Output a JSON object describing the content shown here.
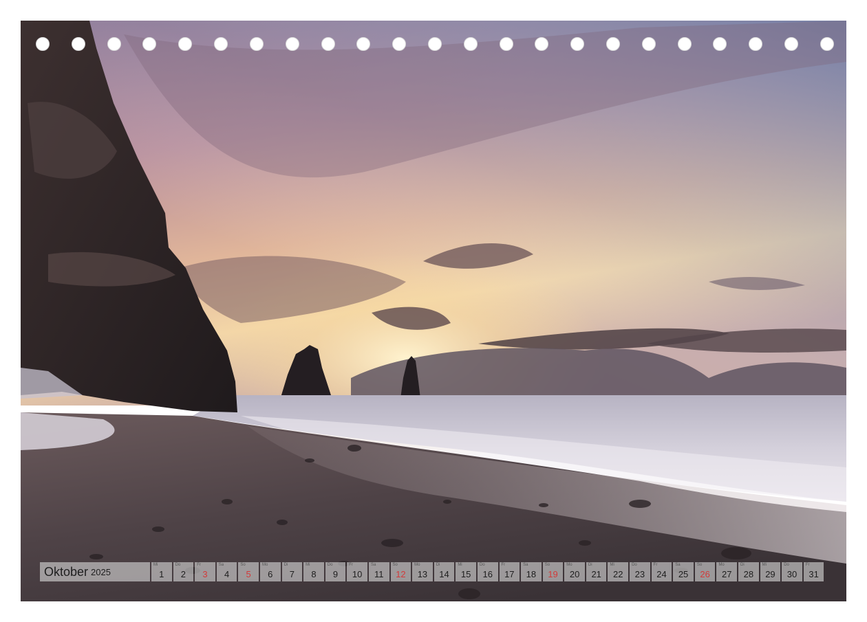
{
  "calendar": {
    "month": "Oktober",
    "year": "2025",
    "days": [
      {
        "d": "1",
        "wd": "Mi",
        "type": "weekday"
      },
      {
        "d": "2",
        "wd": "Do",
        "type": "weekday"
      },
      {
        "d": "3",
        "wd": "Fr",
        "type": "holiday"
      },
      {
        "d": "4",
        "wd": "Sa",
        "type": "sat"
      },
      {
        "d": "5",
        "wd": "So",
        "type": "sun"
      },
      {
        "d": "6",
        "wd": "Mo",
        "type": "weekday"
      },
      {
        "d": "7",
        "wd": "Di",
        "type": "weekday"
      },
      {
        "d": "8",
        "wd": "Mi",
        "type": "weekday"
      },
      {
        "d": "9",
        "wd": "Do",
        "type": "weekday"
      },
      {
        "d": "10",
        "wd": "Fr",
        "type": "weekday"
      },
      {
        "d": "11",
        "wd": "Sa",
        "type": "sat"
      },
      {
        "d": "12",
        "wd": "So",
        "type": "sun"
      },
      {
        "d": "13",
        "wd": "Mo",
        "type": "weekday"
      },
      {
        "d": "14",
        "wd": "Di",
        "type": "weekday"
      },
      {
        "d": "15",
        "wd": "Mi",
        "type": "weekday"
      },
      {
        "d": "16",
        "wd": "Do",
        "type": "weekday"
      },
      {
        "d": "17",
        "wd": "Fr",
        "type": "weekday"
      },
      {
        "d": "18",
        "wd": "Sa",
        "type": "sat"
      },
      {
        "d": "19",
        "wd": "So",
        "type": "sun"
      },
      {
        "d": "20",
        "wd": "Mo",
        "type": "weekday"
      },
      {
        "d": "21",
        "wd": "Di",
        "type": "weekday"
      },
      {
        "d": "22",
        "wd": "Mi",
        "type": "weekday"
      },
      {
        "d": "23",
        "wd": "Do",
        "type": "weekday"
      },
      {
        "d": "24",
        "wd": "Fr",
        "type": "weekday"
      },
      {
        "d": "25",
        "wd": "Sa",
        "type": "sat"
      },
      {
        "d": "26",
        "wd": "So",
        "type": "sun"
      },
      {
        "d": "27",
        "wd": "Mo",
        "type": "weekday"
      },
      {
        "d": "28",
        "wd": "Di",
        "type": "weekday"
      },
      {
        "d": "29",
        "wd": "Mi",
        "type": "weekday"
      },
      {
        "d": "30",
        "wd": "Do",
        "type": "weekday"
      },
      {
        "d": "31",
        "wd": "Fr",
        "type": "weekday"
      }
    ]
  },
  "binding": {
    "hole_count": 23
  },
  "colors": {
    "sunday": "#d23a3a",
    "text": "#1e1e1e"
  }
}
